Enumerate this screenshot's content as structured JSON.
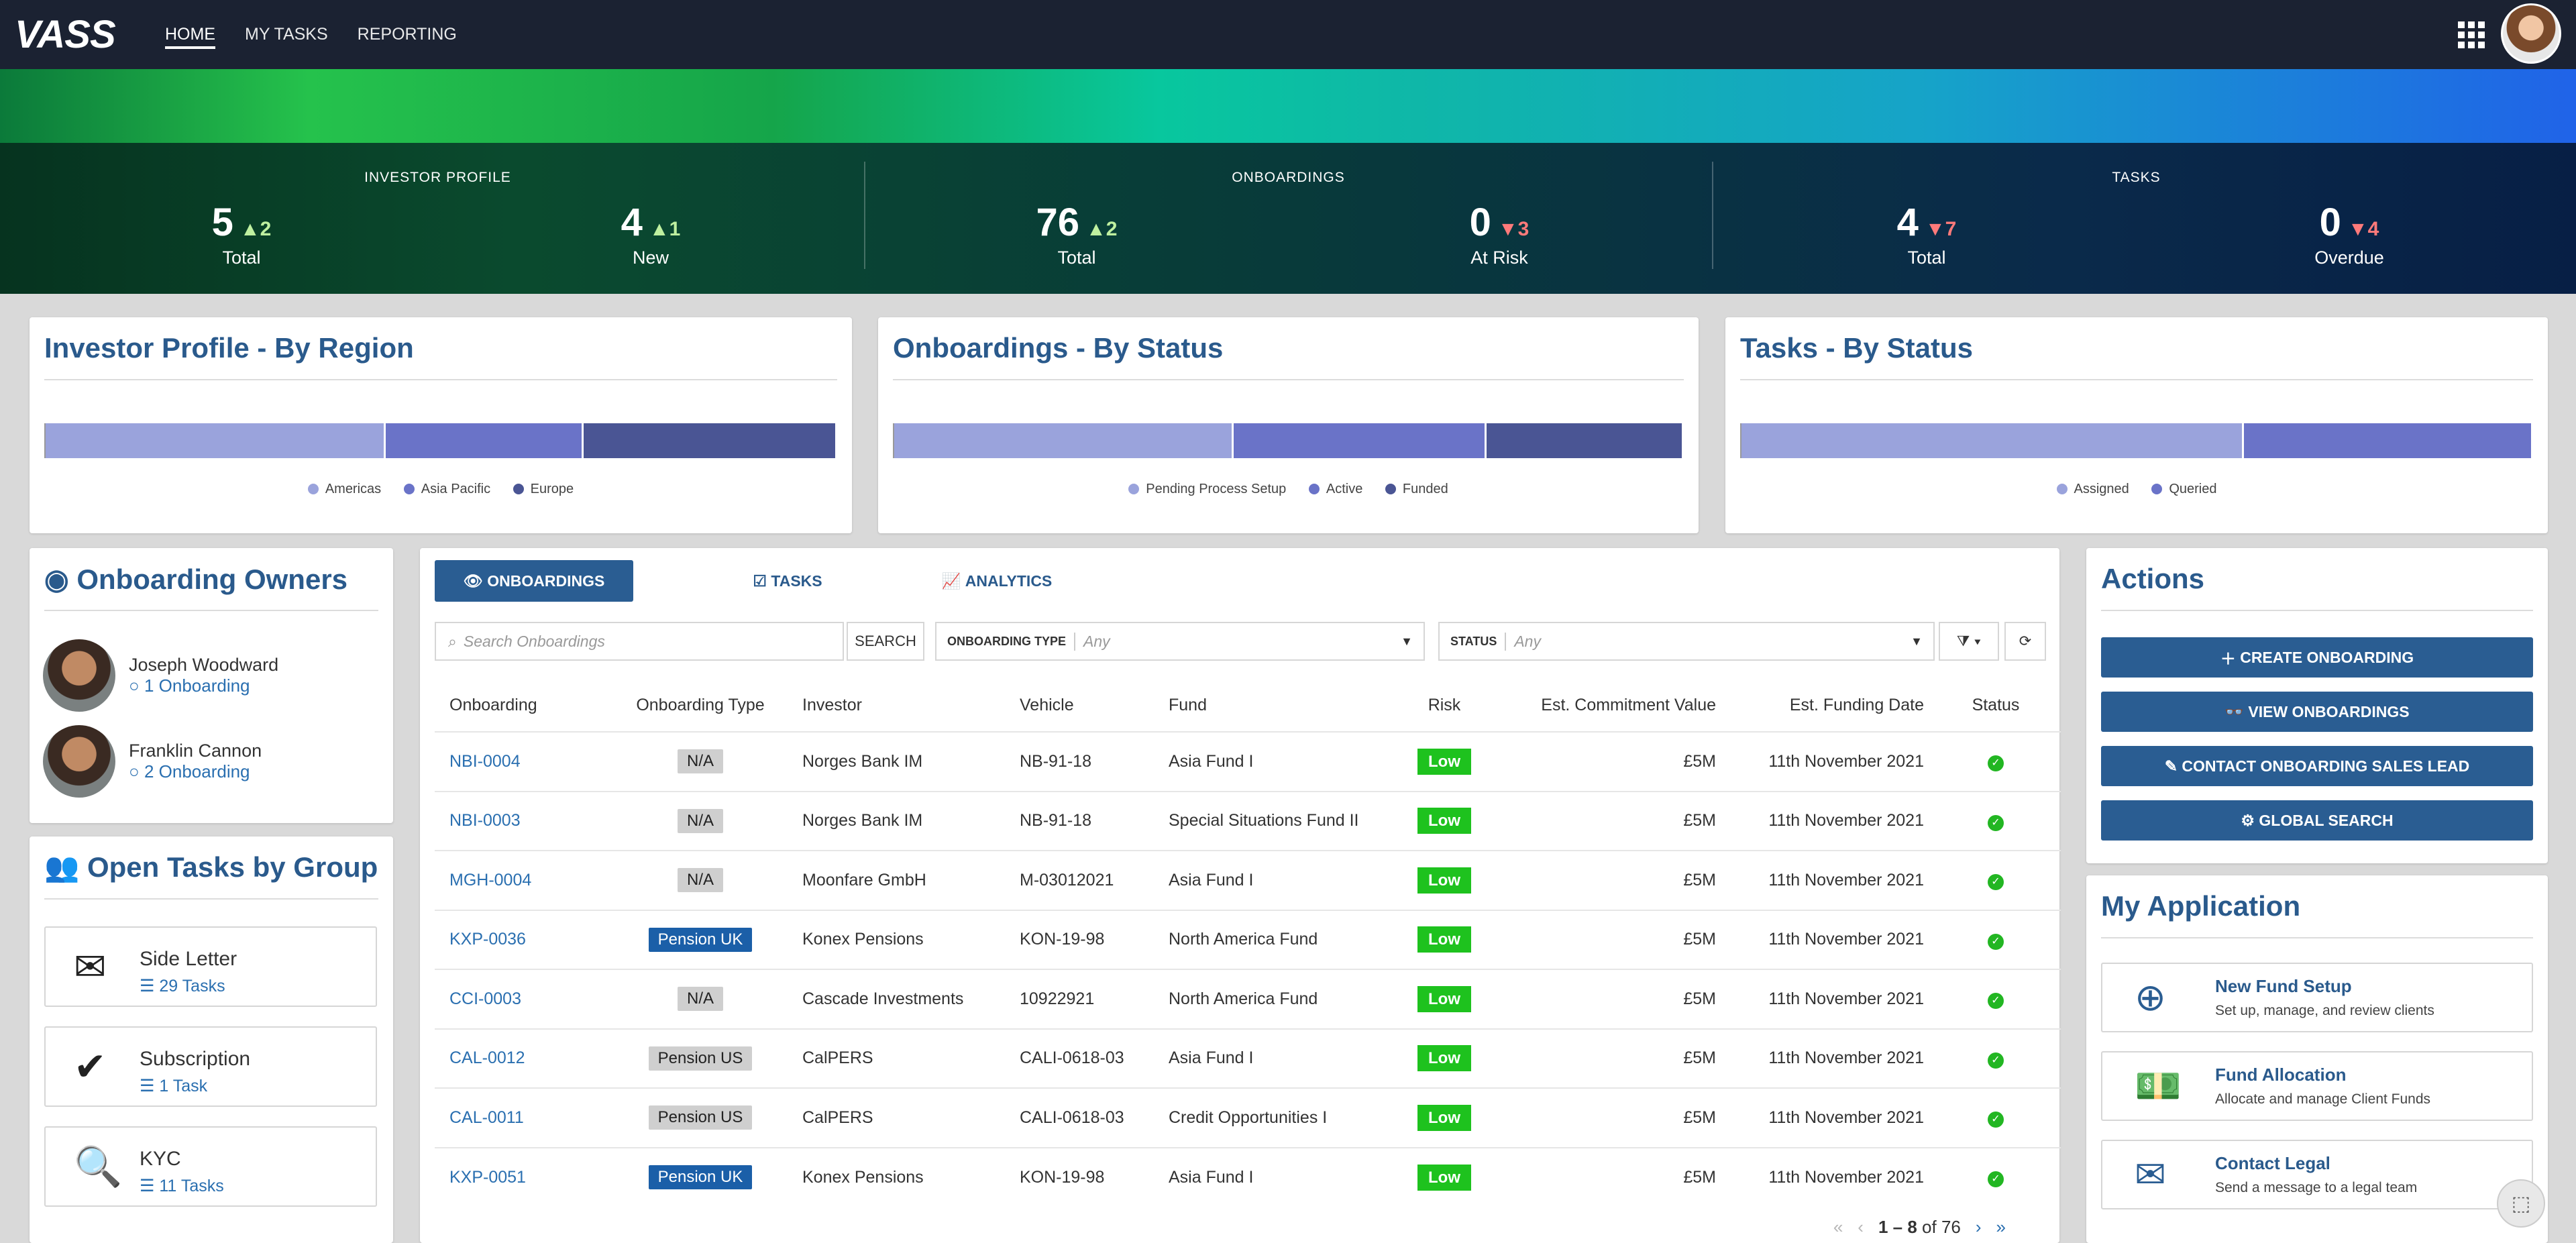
{
  "nav": {
    "logo": "VASS",
    "links": [
      "HOME",
      "MY TASKS",
      "REPORTING"
    ]
  },
  "stats": {
    "groups": [
      {
        "title": "INVESTOR PROFILE",
        "items": [
          {
            "value": "5",
            "delta": "▲2",
            "label": "Total"
          },
          {
            "value": "4",
            "delta": "▲1",
            "label": "New"
          }
        ]
      },
      {
        "title": "ONBOARDINGS",
        "items": [
          {
            "value": "76",
            "delta": "▲2",
            "label": "Total"
          },
          {
            "value": "0",
            "delta": "▼3",
            "label": "At Risk"
          }
        ]
      },
      {
        "title": "TASKS",
        "items": [
          {
            "value": "4",
            "delta": "▼7",
            "label": "Total"
          },
          {
            "value": "0",
            "delta": "▼4",
            "label": "Overdue"
          }
        ]
      }
    ]
  },
  "charts": {
    "region": {
      "title": "Investor Profile - By Region",
      "legend": [
        "Americas",
        "Asia Pacific",
        "Europe"
      ]
    },
    "status": {
      "title": "Onboardings - By Status",
      "legend": [
        "Pending Process Setup",
        "Active",
        "Funded"
      ]
    },
    "tasks": {
      "title": "Tasks - By Status",
      "legend": [
        "Assigned",
        "Queried"
      ]
    },
    "colors": [
      "#9aa3dc",
      "#6a73c8",
      "#4a5594"
    ]
  },
  "owners": {
    "title": "Onboarding Owners",
    "items": [
      {
        "name": "Joseph Woodward",
        "count": "1 Onboarding"
      },
      {
        "name": "Franklin Cannon",
        "count": "2 Onboarding"
      }
    ]
  },
  "taskgroups": {
    "title": "Open Tasks by Group",
    "items": [
      {
        "name": "Side Letter",
        "count": "29 Tasks"
      },
      {
        "name": "Subscription",
        "count": "1 Task"
      },
      {
        "name": "KYC",
        "count": "11 Tasks"
      }
    ]
  },
  "main": {
    "tabs": [
      "ONBOARDINGS",
      "TASKS",
      "ANALYTICS"
    ],
    "search_placeholder": "Search Onboardings",
    "search_button": "SEARCH",
    "type_label": "ONBOARDING TYPE",
    "status_label": "STATUS",
    "any": "Any",
    "columns": [
      "Onboarding",
      "Onboarding Type",
      "Investor",
      "Vehicle",
      "Fund",
      "Risk",
      "Est. Commitment Value",
      "Est. Funding Date",
      "Status"
    ],
    "rows": [
      [
        "NBI-0004",
        "N/A",
        "Norges Bank IM",
        "NB-91-18",
        "Asia Fund I",
        "Low",
        "£5M",
        "11th November 2021"
      ],
      [
        "NBI-0003",
        "N/A",
        "Norges Bank IM",
        "NB-91-18",
        "Special Situations Fund II",
        "Low",
        "£5M",
        "11th November 2021"
      ],
      [
        "MGH-0004",
        "N/A",
        "Moonfare GmbH",
        "M-03012021",
        "Asia Fund I",
        "Low",
        "£5M",
        "11th November 2021"
      ],
      [
        "KXP-0036",
        "Pension UK",
        "Konex Pensions",
        "KON-19-98",
        "North America Fund",
        "Low",
        "£5M",
        "11th November 2021"
      ],
      [
        "CCI-0003",
        "N/A",
        "Cascade Investments",
        "10922921",
        "North America Fund",
        "Low",
        "£5M",
        "11th November 2021"
      ],
      [
        "CAL-0012",
        "Pension US",
        "CalPERS",
        "CALI-0618-03",
        "Asia Fund I",
        "Low",
        "£5M",
        "11th November 2021"
      ],
      [
        "CAL-0011",
        "Pension US",
        "CalPERS",
        "CALI-0618-03",
        "Credit Opportunities I",
        "Low",
        "£5M",
        "11th November 2021"
      ],
      [
        "KXP-0051",
        "Pension UK",
        "Konex Pensions",
        "KON-19-98",
        "Asia Fund I",
        "Low",
        "£5M",
        "11th November 2021"
      ]
    ],
    "pager": {
      "range": "1 – 8",
      "of": "of 76"
    }
  },
  "actions": {
    "title": "Actions",
    "buttons": [
      "CREATE ONBOARDING",
      "VIEW ONBOARDINGS",
      "CONTACT ONBOARDING SALES LEAD",
      "GLOBAL SEARCH"
    ]
  },
  "myapp": {
    "title": "My Application",
    "items": [
      {
        "title": "New Fund Setup",
        "desc": "Set up, manage, and review clients"
      },
      {
        "title": "Fund Allocation",
        "desc": "Allocate and manage Client Funds"
      },
      {
        "title": "Contact Legal",
        "desc": "Send a message to a legal team"
      }
    ]
  }
}
